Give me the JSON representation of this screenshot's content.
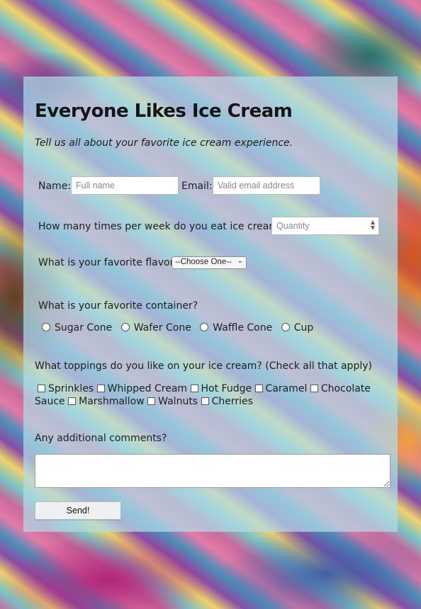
{
  "page": {
    "title": "Everyone Likes Ice Cream",
    "subtitle": "Tell us all about your favorite ice cream experience."
  },
  "form": {
    "name_label": "Name:",
    "name_placeholder": "Full name",
    "email_label": "Email:",
    "email_placeholder": "Valid email address",
    "frequency_label": "How many times per week do you eat ice cream?:",
    "frequency_placeholder": "Quantity",
    "flavor_label": "What is your favorite flavor?",
    "flavor_selected": "--Choose One--",
    "container_label": "What is your favorite container?",
    "containers": [
      "Sugar Cone",
      "Wafer Cone",
      "Waffle Cone",
      "Cup"
    ],
    "toppings_label": "What toppings do you like on your ice cream? (Check all that apply)",
    "toppings": [
      "Sprinkles",
      "Whipped Cream",
      "Hot Fudge",
      "Caramel",
      "Chocolate Sauce",
      "Marshmallow",
      "Walnuts",
      "Cherries"
    ],
    "comments_label": "Any additional comments?",
    "submit_label": "Send!"
  },
  "colors": {
    "card_bg": "#b0dce8",
    "text": "#1e1e1e"
  }
}
